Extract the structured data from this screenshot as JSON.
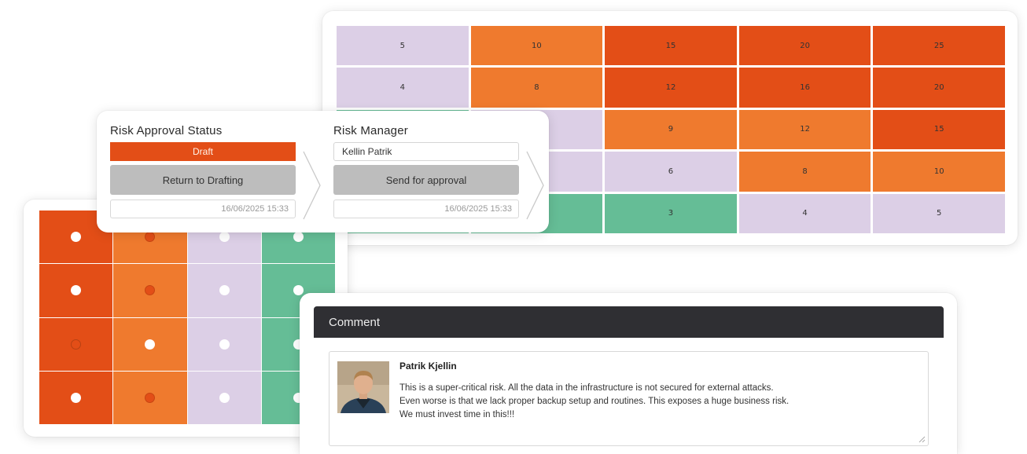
{
  "colors": {
    "lavender": "#dccfe6",
    "orange": "#ef7a2e",
    "red_orange": "#e34e17",
    "teal": "#65bd96",
    "header_dark": "#2f2f33",
    "button_gray": "#bdbdbd"
  },
  "risk_matrix": {
    "rows": [
      [
        {
          "value": "5",
          "level": "lavender"
        },
        {
          "value": "10",
          "level": "orange"
        },
        {
          "value": "15",
          "level": "red_orange"
        },
        {
          "value": "20",
          "level": "red_orange"
        },
        {
          "value": "25",
          "level": "red_orange"
        }
      ],
      [
        {
          "value": "4",
          "level": "lavender"
        },
        {
          "value": "8",
          "level": "orange"
        },
        {
          "value": "12",
          "level": "red_orange"
        },
        {
          "value": "16",
          "level": "red_orange"
        },
        {
          "value": "20",
          "level": "red_orange"
        }
      ],
      [
        {
          "value": "",
          "level": "teal"
        },
        {
          "value": "",
          "level": "lavender"
        },
        {
          "value": "9",
          "level": "orange"
        },
        {
          "value": "12",
          "level": "orange"
        },
        {
          "value": "15",
          "level": "red_orange"
        }
      ],
      [
        {
          "value": "",
          "level": "teal"
        },
        {
          "value": "",
          "level": "lavender"
        },
        {
          "value": "6",
          "level": "lavender"
        },
        {
          "value": "8",
          "level": "orange"
        },
        {
          "value": "10",
          "level": "orange"
        }
      ],
      [
        {
          "value": "",
          "level": "teal"
        },
        {
          "value": "",
          "level": "teal"
        },
        {
          "value": "3",
          "level": "teal"
        },
        {
          "value": "4",
          "level": "lavender"
        },
        {
          "value": "5",
          "level": "lavender"
        }
      ]
    ]
  },
  "dot_grid": {
    "column_colors": [
      "red_orange",
      "orange",
      "lavender",
      "teal"
    ],
    "rows": [
      [
        "white",
        "red",
        "white",
        "white"
      ],
      [
        "white",
        "red",
        "white",
        "white"
      ],
      [
        "outline",
        "white",
        "white",
        "white"
      ],
      [
        "white",
        "red",
        "white",
        "white"
      ]
    ]
  },
  "approval": {
    "status_title": "Risk Approval Status",
    "status_value": "Draft",
    "return_button": "Return to Drafting",
    "status_date": "16/06/2025 15:33",
    "manager_title": "Risk Manager",
    "manager_name": "Kellin Patrik",
    "send_button": "Send for approval",
    "manager_date": "16/06/2025 15:33"
  },
  "comment": {
    "header": "Comment",
    "author": "Patrik Kjellin",
    "lines": [
      "This is a super-critical risk. All the data in the infrastructure is not secured for external attacks.",
      "Even worse is that we lack proper backup setup and routines. This exposes a huge business risk.",
      "We must invest time in this!!!"
    ]
  }
}
